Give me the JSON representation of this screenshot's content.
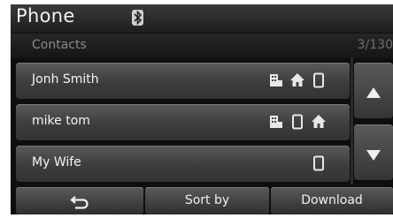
{
  "header": {
    "title": "Phone",
    "bluetooth_icon": "bluetooth-icon"
  },
  "subheader": {
    "label": "Contacts",
    "count": "3/130"
  },
  "contacts": [
    {
      "name": "Jonh Smith",
      "icons": [
        "office-phone-icon",
        "home-phone-icon",
        "mobile-phone-icon"
      ]
    },
    {
      "name": "mike tom",
      "icons": [
        "office-phone-icon",
        "mobile-phone-icon",
        "home-phone-icon"
      ]
    },
    {
      "name": "My Wife",
      "icons": [
        "mobile-phone-icon"
      ]
    }
  ],
  "scroll": {
    "up_icon": "triangle-up-icon",
    "down_icon": "triangle-down-icon"
  },
  "bottom": {
    "back_icon": "back-arrow-icon",
    "sort_label": "Sort by",
    "download_label": "Download"
  },
  "colors": {
    "background": "#0e0e0e",
    "button": "#4a4a4a",
    "text": "#f2f2f2",
    "muted_text": "#8a8a8a"
  }
}
